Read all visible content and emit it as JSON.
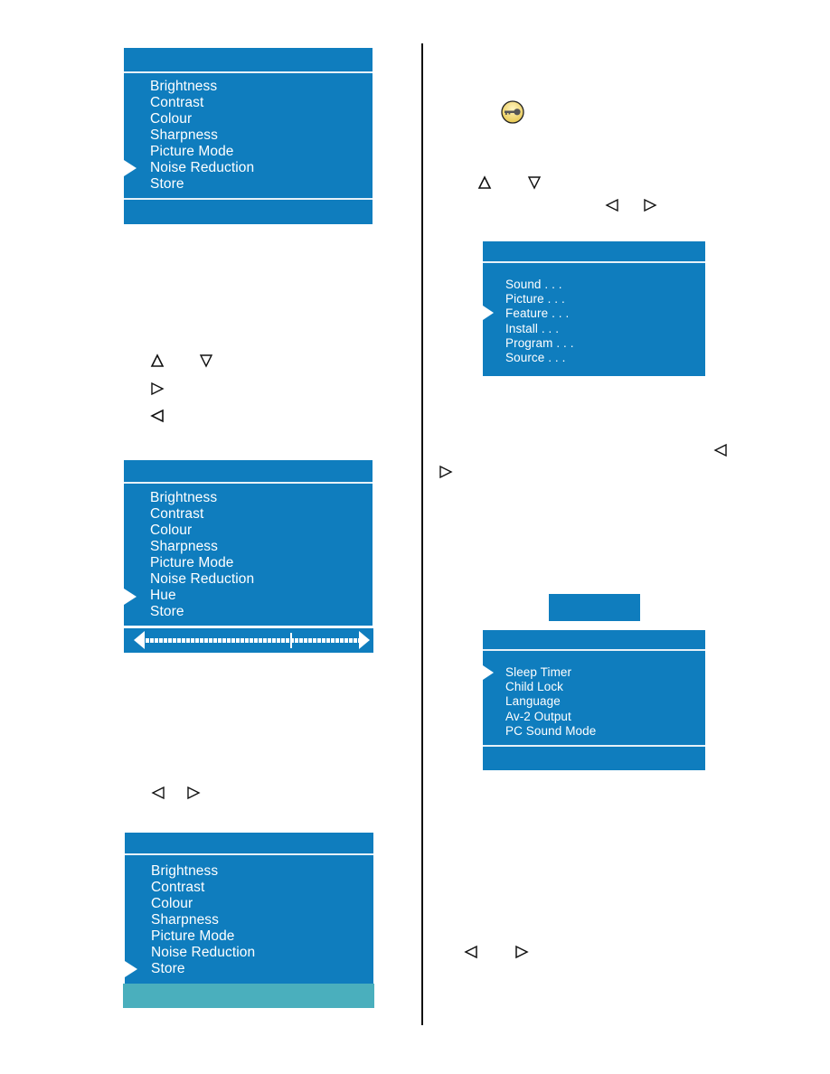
{
  "colors": {
    "menu_bg": "#0f7dbe",
    "menu_text": "#ffffff",
    "footer_highlight": "#4aafbd",
    "key_icon_fill": "#f2d870"
  },
  "picture_menu_1": {
    "items": [
      "Brightness",
      "Contrast",
      "Colour",
      "Sharpness",
      "Picture Mode",
      "Noise Reduction",
      "Store"
    ],
    "selected": "Noise Reduction"
  },
  "nav_keys_left": {
    "row1": [
      "up-triangle-icon",
      "down-triangle-icon"
    ],
    "row2": [
      "right-triangle-icon"
    ],
    "row3": [
      "left-triangle-icon"
    ]
  },
  "picture_menu_2": {
    "items": [
      "Brightness",
      "Contrast",
      "Colour",
      "Sharpness",
      "Picture Mode",
      "Noise Reduction",
      "Hue",
      "Store"
    ],
    "selected": "Hue",
    "slider": {
      "value_fraction": 0.68,
      "left_icon": "left-arrow-icon",
      "right_icon": "right-arrow-icon"
    }
  },
  "nav_keys_left_lower": [
    "left-triangle-icon",
    "right-triangle-icon"
  ],
  "picture_menu_3": {
    "items": [
      "Brightness",
      "Contrast",
      "Colour",
      "Sharpness",
      "Picture Mode",
      "Noise Reduction",
      "Store"
    ],
    "selected": "Store"
  },
  "right_column": {
    "key_icon": "key-icon",
    "nav_row1": [
      "up-triangle-icon",
      "down-triangle-icon"
    ],
    "nav_row2": [
      "left-triangle-icon",
      "right-triangle-icon"
    ],
    "main_menu": {
      "items": [
        "Sound . . .",
        "Picture . . .",
        "Feature . . .",
        "Install . . .",
        "Program . . .",
        "Source . . ."
      ],
      "selected": "Feature . . ."
    },
    "nav_inline": [
      "left-triangle-icon",
      "right-triangle-icon"
    ],
    "feature_menu": {
      "items": [
        "Sleep Timer",
        "Child Lock",
        "Language",
        "Av-2 Output",
        "PC Sound Mode"
      ],
      "selected": "Sleep Timer"
    },
    "nav_bottom": [
      "left-triangle-icon",
      "right-triangle-icon"
    ]
  }
}
